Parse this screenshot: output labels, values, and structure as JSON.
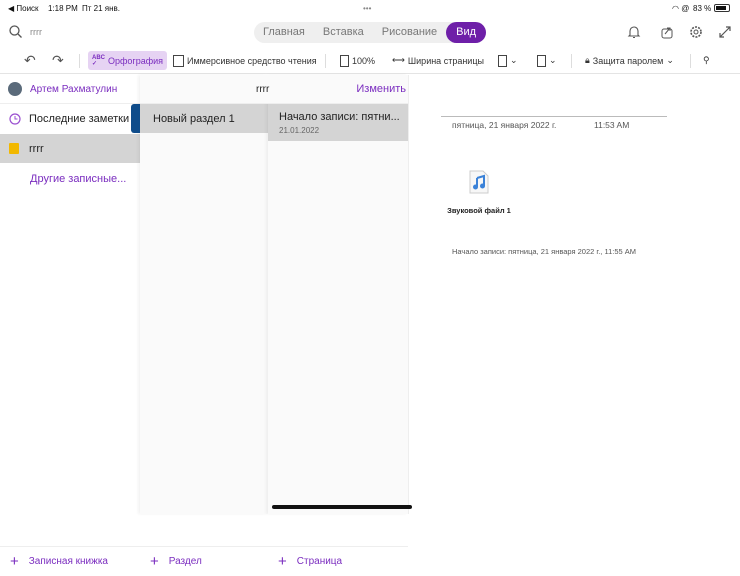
{
  "status": {
    "back": "◀ Поиск",
    "time": "1:18 PM",
    "date": "Пт 21 янв.",
    "dots": "•••",
    "battery": "83 %"
  },
  "search": {
    "value": "rrrr"
  },
  "tabs": [
    {
      "label": "Главная"
    },
    {
      "label": "Вставка"
    },
    {
      "label": "Рисование"
    },
    {
      "label": "Вид",
      "active": true
    }
  ],
  "toolbar": {
    "spelling": "Орфография",
    "immersive": "Иммерсивное средство чтения",
    "zoom": "100%",
    "page_width": "Ширина страницы",
    "password": "Защита паролем"
  },
  "accent": "#7a2cbf",
  "notebooks": {
    "user": "Артем Рахматулин",
    "recent": "Последние заметки",
    "current": "rrrr",
    "other": "Другие записные...",
    "add": "Записная книжка"
  },
  "sections": {
    "title": "rrrr",
    "edit": "Изменить",
    "items": [
      {
        "label": "Новый раздел 1"
      }
    ],
    "add": "Раздел"
  },
  "pages": {
    "items": [
      {
        "title": "Начало записи: пятни...",
        "date": "21.01.2022"
      }
    ],
    "add": "Страница"
  },
  "note": {
    "date": "пятница, 21 января 2022 г.",
    "time": "11:53 AM",
    "attachment": "Звуковой файл 1",
    "recording": "Начало записи: пятница, 21 января 2022 г., 11:55 AM"
  }
}
